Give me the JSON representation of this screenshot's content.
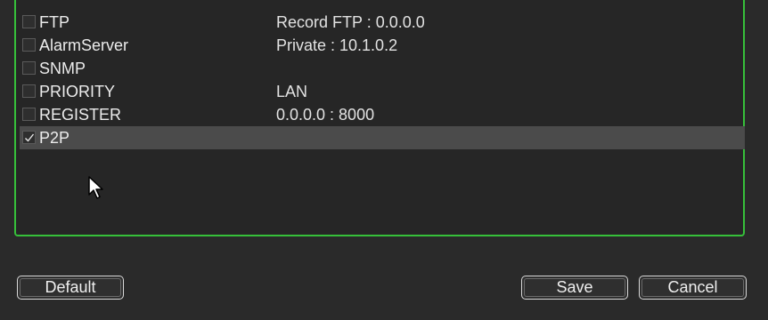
{
  "services": [
    {
      "name": "FTP",
      "detail": "Record FTP : 0.0.0.0",
      "checked": false,
      "selected": false
    },
    {
      "name": "AlarmServer",
      "detail": "Private : 10.1.0.2",
      "checked": false,
      "selected": false
    },
    {
      "name": "SNMP",
      "detail": "",
      "checked": false,
      "selected": false
    },
    {
      "name": "PRIORITY",
      "detail": "LAN",
      "checked": false,
      "selected": false
    },
    {
      "name": "REGISTER",
      "detail": "0.0.0.0 : 8000",
      "checked": false,
      "selected": false
    },
    {
      "name": "P2P",
      "detail": "",
      "checked": true,
      "selected": true
    }
  ],
  "buttons": {
    "default_label": "Default",
    "save_label": "Save",
    "cancel_label": "Cancel"
  },
  "colors": {
    "panel_border": "#36c03a",
    "background": "#2a2a2a",
    "selected_row": "#4b4b4b"
  },
  "icons": {
    "cursor": "mouse-pointer-icon",
    "check": "checkmark-icon"
  }
}
